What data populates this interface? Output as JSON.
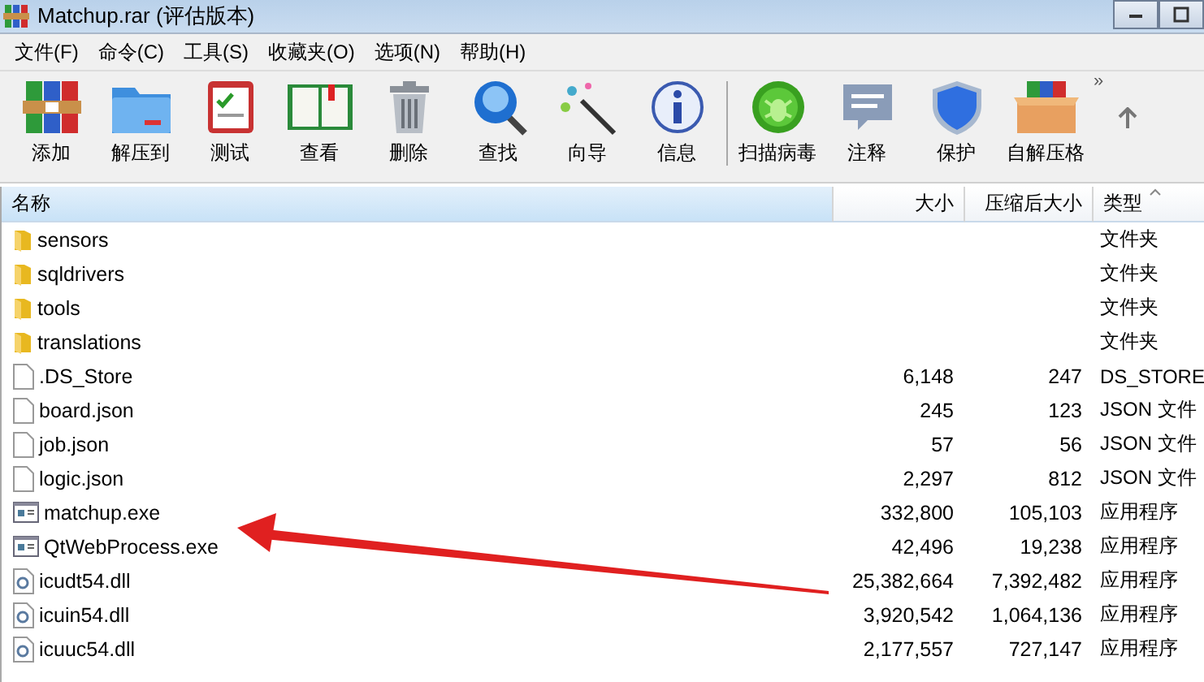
{
  "window": {
    "title": "Matchup.rar (评估版本)"
  },
  "menu": [
    "文件(F)",
    "命令(C)",
    "工具(S)",
    "收藏夹(O)",
    "选项(N)",
    "帮助(H)"
  ],
  "toolbar": [
    {
      "label": "添加"
    },
    {
      "label": "解压到"
    },
    {
      "label": "测试"
    },
    {
      "label": "查看"
    },
    {
      "label": "删除"
    },
    {
      "label": "查找"
    },
    {
      "label": "向导"
    },
    {
      "label": "信息"
    },
    {
      "label": "扫描病毒"
    },
    {
      "label": "注释"
    },
    {
      "label": "保护"
    },
    {
      "label": "自解压格"
    }
  ],
  "toolbar_more": "»",
  "columns": [
    {
      "label": "名称",
      "sorted": false
    },
    {
      "label": "大小",
      "sorted": false
    },
    {
      "label": "压缩后大小",
      "sorted": false
    },
    {
      "label": "类型",
      "sorted": true
    }
  ],
  "rows": [
    {
      "kind": "folder",
      "name": "sensors",
      "size": "",
      "packed": "",
      "type": "文件夹"
    },
    {
      "kind": "folder",
      "name": "sqldrivers",
      "size": "",
      "packed": "",
      "type": "文件夹"
    },
    {
      "kind": "folder",
      "name": "tools",
      "size": "",
      "packed": "",
      "type": "文件夹"
    },
    {
      "kind": "folder",
      "name": "translations",
      "size": "",
      "packed": "",
      "type": "文件夹"
    },
    {
      "kind": "file",
      "name": ".DS_Store",
      "size": "6,148",
      "packed": "247",
      "type": "DS_STORE"
    },
    {
      "kind": "file",
      "name": "board.json",
      "size": "245",
      "packed": "123",
      "type": "JSON 文件"
    },
    {
      "kind": "file",
      "name": "job.json",
      "size": "57",
      "packed": "56",
      "type": "JSON 文件"
    },
    {
      "kind": "file",
      "name": "logic.json",
      "size": "2,297",
      "packed": "812",
      "type": "JSON 文件"
    },
    {
      "kind": "exe",
      "name": "matchup.exe",
      "size": "332,800",
      "packed": "105,103",
      "type": "应用程序"
    },
    {
      "kind": "exe",
      "name": "QtWebProcess.exe",
      "size": "42,496",
      "packed": "19,238",
      "type": "应用程序"
    },
    {
      "kind": "dll",
      "name": "icudt54.dll",
      "size": "25,382,664",
      "packed": "7,392,482",
      "type": "应用程序"
    },
    {
      "kind": "dll",
      "name": "icuin54.dll",
      "size": "3,920,542",
      "packed": "1,064,136",
      "type": "应用程序"
    },
    {
      "kind": "dll",
      "name": "icuuc54.dll",
      "size": "2,177,557",
      "packed": "727,147",
      "type": "应用程序"
    }
  ]
}
